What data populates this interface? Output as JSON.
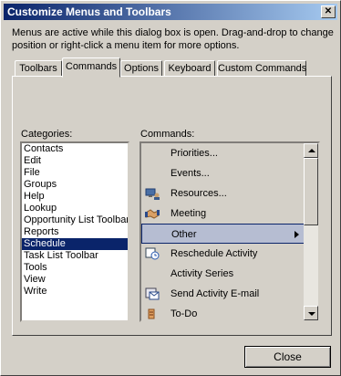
{
  "window": {
    "title": "Customize Menus and Toolbars"
  },
  "description": "Menus are active while this dialog box is open. Drag-and-drop to change position or right-click a menu item for more options.",
  "tabs": [
    {
      "label": "Toolbars"
    },
    {
      "label": "Commands"
    },
    {
      "label": "Options"
    },
    {
      "label": "Keyboard"
    },
    {
      "label": "Custom Commands"
    }
  ],
  "active_tab": "Commands",
  "categories": {
    "label": "Categories:",
    "items": [
      "Contacts",
      "Edit",
      "File",
      "Groups",
      "Help",
      "Lookup",
      "Opportunity List Toolbar",
      "Reports",
      "Schedule",
      "Task List Toolbar",
      "Tools",
      "View",
      "Write"
    ],
    "selected": "Schedule"
  },
  "commands": {
    "label": "Commands:",
    "items": [
      {
        "label": "Priorities...",
        "icon": "none"
      },
      {
        "label": "Events...",
        "icon": "none"
      },
      {
        "label": "Resources...",
        "icon": "resources-icon"
      },
      {
        "label": "Meeting",
        "icon": "handshake-icon"
      },
      {
        "label": "Other",
        "icon": "none",
        "submenu": true
      },
      {
        "label": "Reschedule Activity",
        "icon": "reschedule-icon"
      },
      {
        "label": "Activity Series",
        "icon": "none"
      },
      {
        "label": "Send Activity E-mail",
        "icon": "email-icon"
      },
      {
        "label": "To-Do",
        "icon": "todo-icon"
      }
    ],
    "selected": "Other"
  },
  "buttons": {
    "close": "Close"
  },
  "colors": {
    "titlebar": "#0a246a",
    "selection": "#0a246a",
    "face": "#d4d0c8"
  }
}
